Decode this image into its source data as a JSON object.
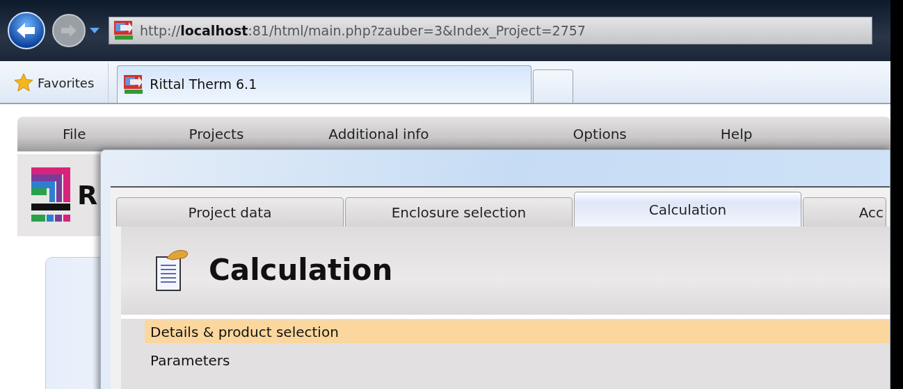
{
  "browser": {
    "address": "http://**localhost**:81/html/main.php?zauber=3&Index_Project=2757",
    "favorites": "Favorites",
    "tabs": [
      {
        "label": "Rittal Therm 6.1",
        "selected": true
      }
    ]
  },
  "menu": [
    "File",
    "Projects",
    "Additional info",
    "Options",
    "Help"
  ],
  "app": {
    "title_fragment": "R"
  },
  "dialog": {
    "tabs": [
      {
        "label": "Project data",
        "selected": false
      },
      {
        "label": "Enclosure selection",
        "selected": false
      },
      {
        "label": "Calculation",
        "selected": true
      },
      {
        "label": "Acc",
        "selected": false
      }
    ],
    "heading": "Calculation",
    "items": [
      {
        "label": "Details & product selection",
        "selected": true
      },
      {
        "label": "Parameters",
        "selected": false
      }
    ]
  }
}
